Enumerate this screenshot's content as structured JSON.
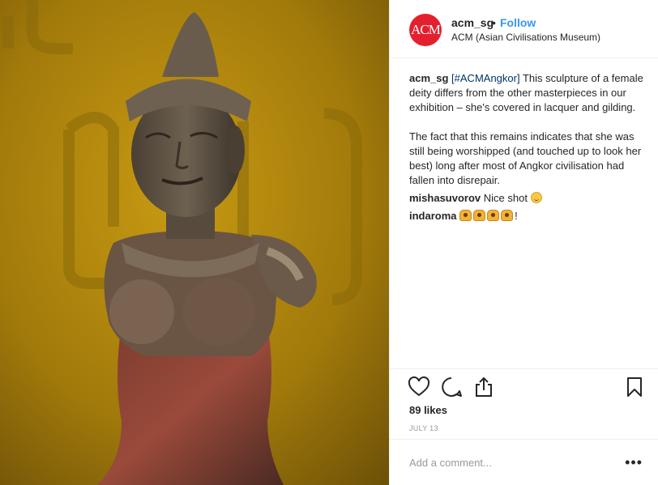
{
  "post": {
    "username": "acm_sg",
    "separator": "•",
    "follow_label": "Follow",
    "location": "ACM (Asian Civilisations Museum)",
    "avatar_text": "ACM",
    "brand_color": "#e4202e",
    "caption": {
      "username": "acm_sg",
      "hashtag": "[#ACMAngkor]",
      "text_1": "This sculpture of a female deity differs from the other masterpieces in our exhibition – she's covered in lacquer and gilding.",
      "text_2": "The fact that this remains indicates that she was still being worshipped (and touched up to look her best) long after most of Angkor civilisation had fallen into disrepair."
    },
    "comments": [
      {
        "username": "mishasuvorov",
        "text": "Nice shot",
        "emoji": "smiling-face"
      },
      {
        "username": "indaroma",
        "text": "!",
        "emoji": "raising-hands x4"
      }
    ],
    "likes": "89 likes",
    "date": "JULY 13",
    "add_comment_placeholder": "Add a comment...",
    "more_icon": "•••",
    "icons": [
      "heart-icon",
      "comment-icon",
      "share-icon",
      "bookmark-icon"
    ]
  }
}
